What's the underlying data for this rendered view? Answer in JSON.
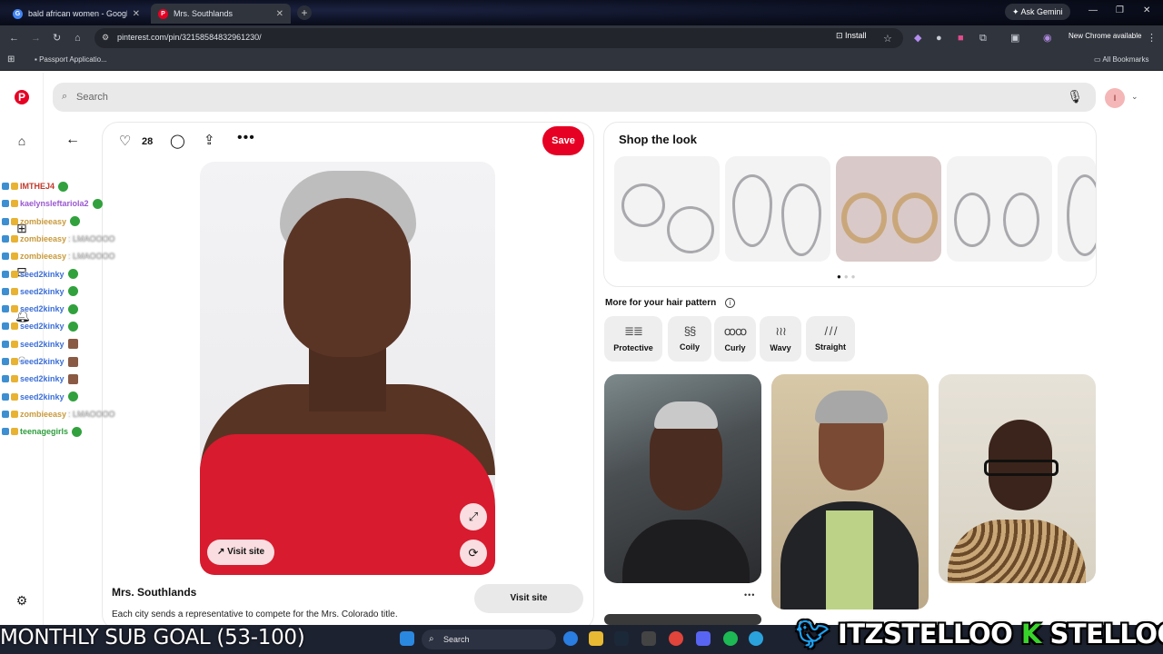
{
  "browser": {
    "tabs": [
      {
        "title": "bald african women - Google S",
        "active": false
      },
      {
        "title": "Mrs. Southlands",
        "active": true
      }
    ],
    "ask_gemini": "Ask Gemini",
    "url": "pinterest.com/pin/32158584832961230/",
    "install_label": "Install",
    "new_chrome_label": "New Chrome available",
    "bookmarks": {
      "passport": "Passport Applicatio...",
      "all_bookmarks": "All Bookmarks"
    }
  },
  "pinterest": {
    "search_placeholder": "Search",
    "avatar_initial": "I",
    "pin": {
      "likes": "28",
      "save_label": "Save",
      "visit_chip": "Visit site",
      "title": "Mrs. Southlands",
      "description": "Each city sends a representative to compete for the Mrs. Colorado title.",
      "visit_site_label": "Visit site"
    },
    "shop": {
      "title": "Shop the look"
    },
    "hair_pattern": {
      "title": "More for your hair pattern",
      "items": [
        {
          "label": "Protective",
          "icon": "protective-icon"
        },
        {
          "label": "Coily",
          "icon": "coily-icon"
        },
        {
          "label": "Curly",
          "icon": "curly-icon"
        },
        {
          "label": "Wavy",
          "icon": "wavy-icon"
        },
        {
          "label": "Straight",
          "icon": "straight-icon"
        }
      ]
    }
  },
  "overlay": {
    "chat": [
      {
        "user": "IMTHEJ4",
        "color": "#c0392b",
        "msg": ""
      },
      {
        "user": "kaelynsleftariola2",
        "color": "#9b59d0",
        "msg": ""
      },
      {
        "user": "zombieeasy",
        "color": "#c89a3a",
        "msg": ""
      },
      {
        "user": "zombieeasy",
        "color": "#c89a3a",
        "msg": ": LMAOOOO"
      },
      {
        "user": "zombieeasy",
        "color": "#c89a3a",
        "msg": ": LMAOOOO"
      },
      {
        "user": "seed2kinky",
        "color": "#3b6fd8",
        "msg": ""
      },
      {
        "user": "seed2kinky",
        "color": "#3b6fd8",
        "msg": ""
      },
      {
        "user": "seed2kinky",
        "color": "#3b6fd8",
        "msg": ""
      },
      {
        "user": "seed2kinky",
        "color": "#3b6fd8",
        "msg": ""
      },
      {
        "user": "seed2kinky",
        "color": "#3b6fd8",
        "msg": ""
      },
      {
        "user": "seed2kinky",
        "color": "#3b6fd8",
        "msg": ""
      },
      {
        "user": "seed2kinky",
        "color": "#3b6fd8",
        "msg": ""
      },
      {
        "user": "seed2kinky",
        "color": "#3b6fd8",
        "msg": ""
      },
      {
        "user": "zombieeasy",
        "color": "#c89a3a",
        "msg": ": LMAOOOO"
      },
      {
        "user": "teenagegirls",
        "color": "#2e9e3c",
        "msg": ""
      }
    ],
    "sub_goal": "MONTHLY SUB GOAL (53-100)",
    "taskbar_search": "Search",
    "handles_left": "ITZSTELLOO",
    "handles_right": "STELLOOO"
  }
}
